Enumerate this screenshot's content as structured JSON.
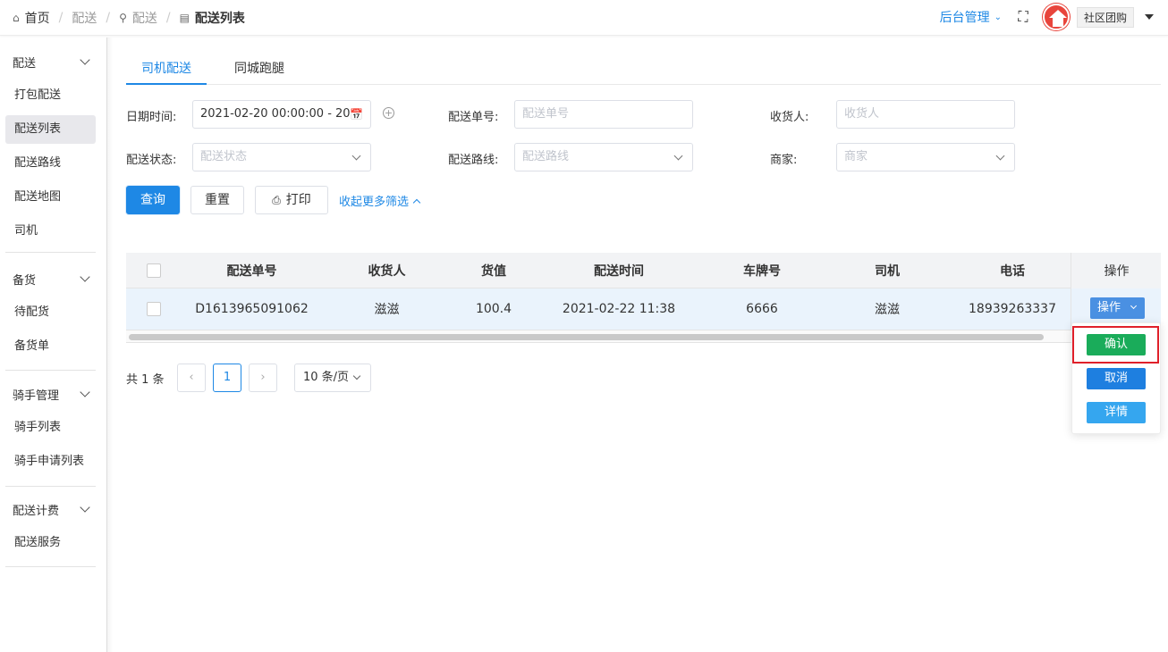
{
  "breadcrumb": {
    "home": "首页",
    "level1": "配送",
    "level2": "配送",
    "current": "配送列表"
  },
  "header": {
    "admin_menu": "后台管理",
    "store_name": "社区团购"
  },
  "sidebar": {
    "groups": [
      {
        "title": "配送",
        "items": [
          "打包配送",
          "配送列表",
          "配送路线",
          "配送地图",
          "司机"
        ]
      },
      {
        "title": "备货",
        "items": [
          "待配货",
          "备货单"
        ]
      },
      {
        "title": "骑手管理",
        "items": [
          "骑手列表",
          "骑手申请列表"
        ]
      },
      {
        "title": "配送计费",
        "items": [
          "配送服务"
        ]
      }
    ],
    "active_item": "配送列表"
  },
  "tabs": [
    "司机配送",
    "同城跑腿"
  ],
  "active_tab": "司机配送",
  "filters": {
    "date_label": "日期时间:",
    "date_value": "2021-02-20 00:00:00 - 20",
    "order_no_label": "配送单号:",
    "order_no_placeholder": "配送单号",
    "receiver_label": "收货人:",
    "receiver_placeholder": "收货人",
    "status_label": "配送状态:",
    "status_placeholder": "配送状态",
    "route_label": "配送路线:",
    "route_placeholder": "配送路线",
    "merchant_label": "商家:",
    "merchant_placeholder": "商家"
  },
  "actions": {
    "query": "查询",
    "reset": "重置",
    "print": "打印",
    "collapse_filters": "收起更多筛选"
  },
  "table": {
    "columns": [
      "配送单号",
      "收货人",
      "货值",
      "配送时间",
      "车牌号",
      "司机",
      "电话",
      "操作"
    ],
    "rows": [
      {
        "order_no": "D1613965091062",
        "receiver": "滋滋",
        "value": "100.4",
        "time": "2021-02-22 11:38",
        "plate": "6666",
        "driver": "滋滋",
        "phone": "18939263337",
        "op_button": "操作"
      }
    ]
  },
  "dropdown": {
    "confirm": "确认",
    "cancel": "取消",
    "detail": "详情"
  },
  "pagination": {
    "total": "共 1 条",
    "current_page": "1",
    "page_size": "10 条/页"
  },
  "colors": {
    "primary": "#1e88e5",
    "confirm": "#1aac5a",
    "cancel": "#1e7fe0",
    "detail": "#35a6ef",
    "highlight": "#e0202a"
  }
}
